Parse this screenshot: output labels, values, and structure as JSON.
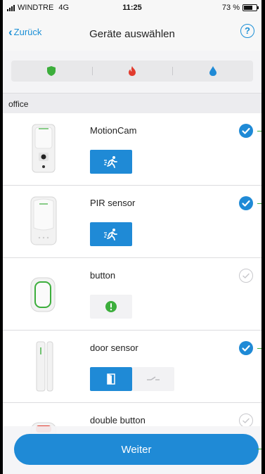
{
  "status_bar": {
    "carrier": "WINDTRE",
    "network": "4G",
    "time": "11:25",
    "battery": "73 %"
  },
  "nav": {
    "back_label": "Zurück",
    "title": "Geräte auswählen",
    "help_label": "?"
  },
  "filters": [
    {
      "icon": "shield-icon",
      "color": "#3cae3c"
    },
    {
      "icon": "flame-icon",
      "color": "#e23b2e"
    },
    {
      "icon": "water-drop-icon",
      "color": "#1f8ad6"
    }
  ],
  "section": {
    "title": "office"
  },
  "devices": [
    {
      "name": "MotionCam",
      "selected": true,
      "modes": [
        "running-person-icon"
      ]
    },
    {
      "name": "PIR sensor",
      "selected": true,
      "modes": [
        "running-person-icon"
      ]
    },
    {
      "name": "button",
      "selected": false,
      "modes": [
        "alert-icon"
      ]
    },
    {
      "name": "door sensor",
      "selected": true,
      "modes": [
        "door-icon",
        "reed-switch-icon"
      ]
    },
    {
      "name": "double button",
      "selected": false,
      "modes": []
    }
  ],
  "footer": {
    "continue_label": "Weiter"
  },
  "colors": {
    "accent": "#1f8ad6",
    "green": "#3cae3c",
    "red": "#e23b2e"
  }
}
